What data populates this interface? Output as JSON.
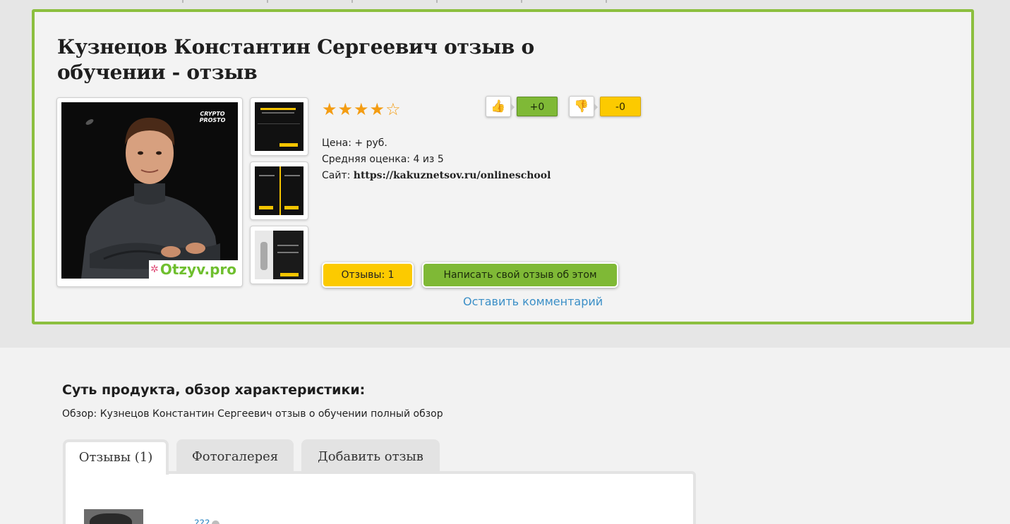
{
  "product": {
    "title": "Кузнецов Константин Сергеевич отзыв о обучении - отзыв",
    "rating_stars": "★★★★☆",
    "rating_value": 4,
    "rating_max": 5,
    "price": "Цена: + руб.",
    "average_rating": "Средняя оценка: 4 из 5",
    "site_label": "Сайт:",
    "site_url": "https://kakuznetsov.ru/onlineschool",
    "main_photo_logo": "Otzyv.pro",
    "main_photo_badge": "CRYPTO PROSTO"
  },
  "votes": {
    "up_icon": "thumbs-up-icon",
    "up_count": "+0",
    "down_icon": "thumbs-down-icon",
    "down_count": "-0"
  },
  "actions": {
    "reviews_button": "Отзывы: 1",
    "write_button": "Написать свой отзыв об этом",
    "comment_link": "Оставить комментарий"
  },
  "section": {
    "title": "Суть продукта, обзор характеристики:",
    "overview": "Обзор: Кузнецов Константин Сергеевич отзыв о обучении полный обзор"
  },
  "tabs": [
    {
      "label": "Отзывы (1)",
      "active": true
    },
    {
      "label": "Фотогалерея",
      "active": false
    },
    {
      "label": "Добавить отзыв",
      "active": false
    }
  ],
  "review": {
    "user": "???"
  },
  "colors": {
    "accent_green": "#8cbf3f",
    "button_green": "#7fb936",
    "button_yellow": "#fcca00",
    "link_blue": "#3b8fc7",
    "star_orange": "#f39c12"
  }
}
